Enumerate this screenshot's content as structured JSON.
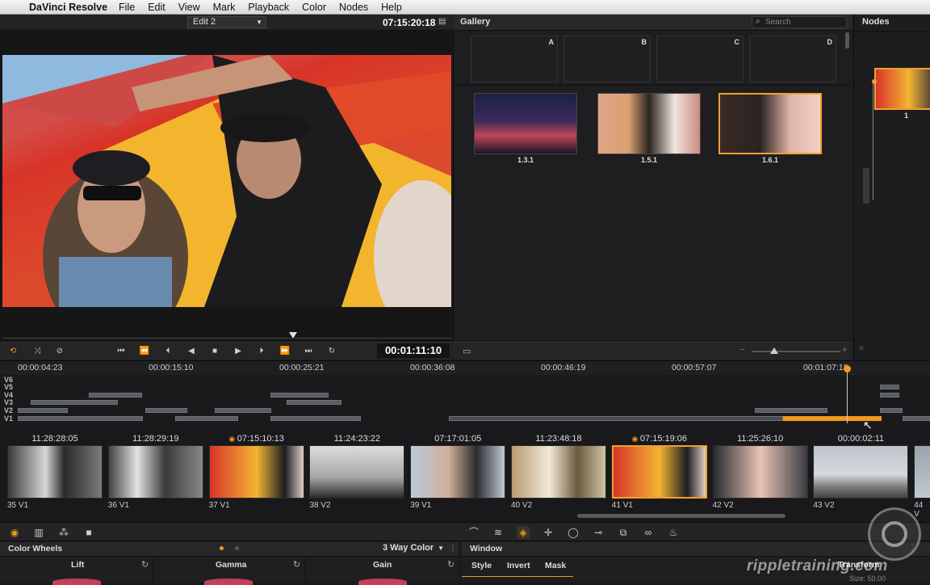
{
  "menubar": {
    "app_name": "DaVinci Resolve",
    "items": [
      "File",
      "Edit",
      "View",
      "Mark",
      "Playback",
      "Color",
      "Nodes",
      "Help"
    ]
  },
  "viewer": {
    "timeline_name": "Edit 2",
    "source_timecode": "07:15:20:18",
    "record_timecode": "00:01:11:10"
  },
  "gallery": {
    "title": "Gallery",
    "search_placeholder": "Search",
    "memories": [
      "A",
      "B",
      "C",
      "D"
    ],
    "stills": [
      {
        "label": "1.3.1"
      },
      {
        "label": "1.5.1"
      },
      {
        "label": "1.6.1",
        "selected": true
      }
    ]
  },
  "nodes": {
    "title": "Nodes",
    "node_label": "1"
  },
  "timeline": {
    "ruler": [
      "00:00:04:23",
      "00:00:15:10",
      "00:00:25:21",
      "00:00:36:08",
      "00:00:46:19",
      "00:00:57:07",
      "00:01:07:18"
    ],
    "tracks": [
      "V6",
      "V5",
      "V4",
      "V3",
      "V2",
      "V1"
    ]
  },
  "clips": [
    {
      "tc": "11:28:28:05",
      "name": "35 V1",
      "graded": false
    },
    {
      "tc": "11:28:29:19",
      "name": "36 V1",
      "graded": false
    },
    {
      "tc": "07:15:10:13",
      "name": "37 V1",
      "graded": true
    },
    {
      "tc": "11:24:23:22",
      "name": "38 V2",
      "graded": false
    },
    {
      "tc": "07:17:01:05",
      "name": "39 V1",
      "graded": false
    },
    {
      "tc": "11:23:48:18",
      "name": "40 V2",
      "graded": false
    },
    {
      "tc": "07:15:19:06",
      "name": "41 V1",
      "graded": true,
      "current": true
    },
    {
      "tc": "11:25:26:10",
      "name": "42 V2",
      "graded": false
    },
    {
      "tc": "00:00:02:11",
      "name": "43 V2",
      "graded": false
    },
    {
      "tc": "",
      "name": "44 V",
      "graded": false
    }
  ],
  "color_wheels": {
    "title": "Color Wheels",
    "mode": "3 Way Color",
    "wheels": [
      "Lift",
      "Gamma",
      "Gain"
    ]
  },
  "window_panel": {
    "title": "Window",
    "tabs": [
      "Style",
      "Invert",
      "Mask"
    ],
    "right_label": "Transform",
    "size_label": "Size: 50.00"
  },
  "watermark": "rippletraining.com",
  "colors": {
    "accent": "#f39a1c",
    "selection": "#f0a030"
  }
}
